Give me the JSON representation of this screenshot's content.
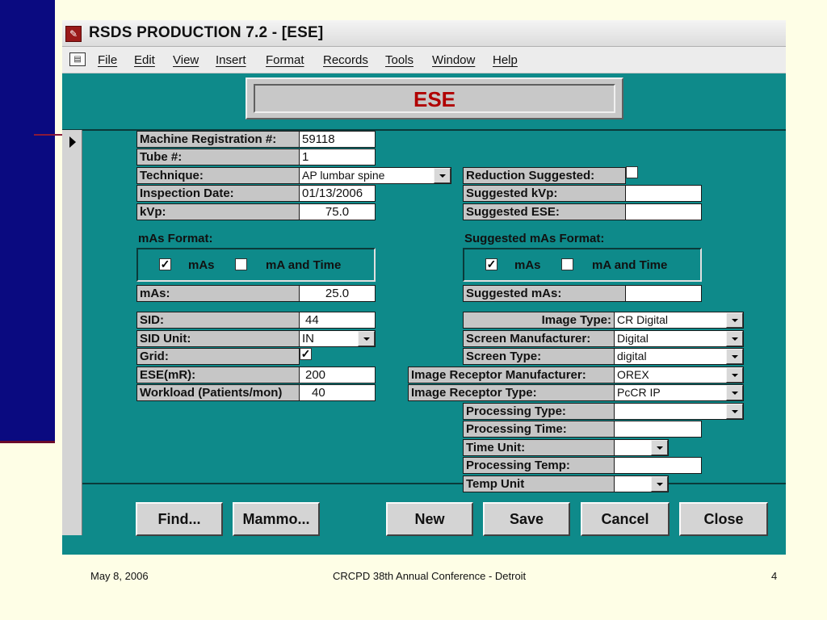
{
  "window": {
    "title": "RSDS PRODUCTION 7.2 - [ESE]"
  },
  "menu": {
    "items": [
      "File",
      "Edit",
      "View",
      "Insert",
      "Format",
      "Records",
      "Tools",
      "Window",
      "Help"
    ]
  },
  "form": {
    "title": "ESE",
    "left": {
      "machine_registration": {
        "label": "Machine Registration #:",
        "value": "59118"
      },
      "tube": {
        "label": "Tube #:",
        "value": "1"
      },
      "technique": {
        "label": "Technique:",
        "value": "AP lumbar spine"
      },
      "inspection_date": {
        "label": "Inspection Date:",
        "value": "01/13/2006"
      },
      "kvp": {
        "label": "kVp:",
        "value": "75.0"
      },
      "mas_format": {
        "title": "mAs Format:",
        "mas_label": "mAs",
        "mas_checked": true,
        "ma_time_label": "mA and Time",
        "ma_time_checked": false
      },
      "mas": {
        "label": "mAs:",
        "value": "25.0"
      },
      "sid": {
        "label": "SID:",
        "value": "44"
      },
      "sid_unit": {
        "label": "SID Unit:",
        "value": "IN"
      },
      "grid": {
        "label": "Grid:",
        "checked": true
      },
      "ese_mr": {
        "label": "ESE(mR):",
        "value": "200"
      },
      "workload": {
        "label": "Workload (Patients/mon)",
        "value": "40"
      }
    },
    "right": {
      "reduction_suggested": {
        "label": "Reduction Suggested:",
        "checked": false
      },
      "suggested_kvp": {
        "label": "Suggested kVp:",
        "value": ""
      },
      "suggested_ese": {
        "label": "Suggested ESE:",
        "value": ""
      },
      "suggested_mas_format": {
        "title": "Suggested mAs Format:",
        "mas_label": "mAs",
        "mas_checked": true,
        "ma_time_label": "mA and Time",
        "ma_time_checked": false
      },
      "suggested_mas": {
        "label": "Suggested mAs:",
        "value": ""
      },
      "image_type": {
        "label": "Image Type:",
        "value": "CR Digital"
      },
      "screen_manufacturer": {
        "label": "Screen Manufacturer:",
        "value": "Digital"
      },
      "screen_type": {
        "label": "Screen Type:",
        "value": "digital"
      },
      "image_receptor_manufacturer": {
        "label": "Image Receptor Manufacturer:",
        "value": "OREX"
      },
      "image_receptor_type": {
        "label": "Image Receptor Type:",
        "value": "PcCR IP"
      },
      "processing_type": {
        "label": "Processing Type:",
        "value": ""
      },
      "processing_time": {
        "label": "Processing Time:",
        "value": ""
      },
      "time_unit": {
        "label": "Time Unit:",
        "value": ""
      },
      "processing_temp": {
        "label": "Processing Temp:",
        "value": ""
      },
      "temp_unit": {
        "label": "Temp Unit",
        "value": ""
      }
    },
    "buttons": {
      "find": "Find...",
      "mammo": "Mammo...",
      "new": "New",
      "save": "Save",
      "cancel": "Cancel",
      "close": "Close"
    }
  },
  "footer": {
    "date": "May 8, 2006",
    "conference": "CRCPD 38th Annual Conference - Detroit",
    "page": "4"
  },
  "colors": {
    "form_bg": "#0e8a8a",
    "title_red": "#b00000",
    "slide_bg": "#fefee6",
    "left_bar": "#0a0a80"
  }
}
